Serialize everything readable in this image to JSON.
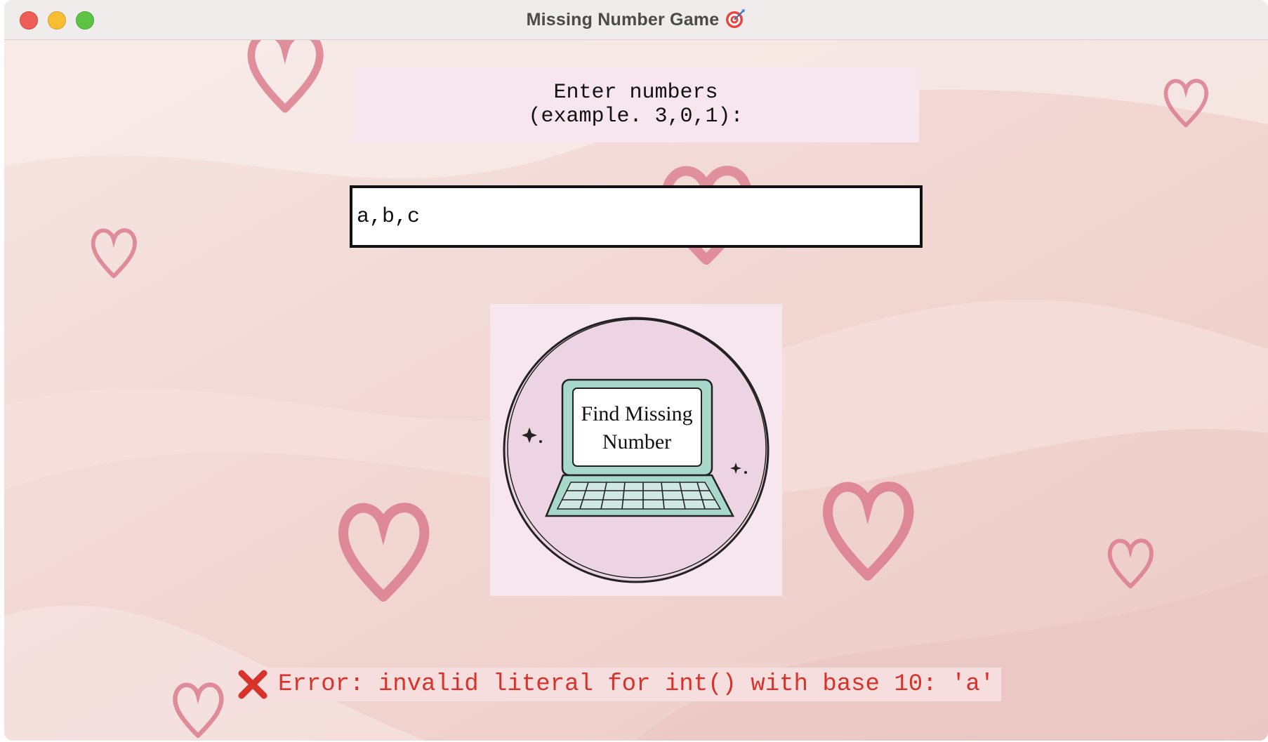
{
  "window": {
    "title": "Missing Number Game",
    "title_icon": "dart-target-icon"
  },
  "traffic_lights": [
    "close",
    "minimize",
    "zoom"
  ],
  "prompt": {
    "text": "Enter numbers\n(example. 3,0,1):"
  },
  "input": {
    "value": "a,b,c"
  },
  "logo": {
    "line1": "Find Missing",
    "line2": "Number",
    "icon": "laptop-icon"
  },
  "error": {
    "icon": "cross-mark-icon",
    "message": "Error: invalid literal for int() with base 10: 'a'"
  },
  "colors": {
    "background": "#f3d9d6",
    "heart": "#d9768a",
    "prompt_bg": "#f8e6ef",
    "logo_circle": "#ecd4e2",
    "laptop": "#a8d8cc",
    "error_text": "#d8322a"
  }
}
